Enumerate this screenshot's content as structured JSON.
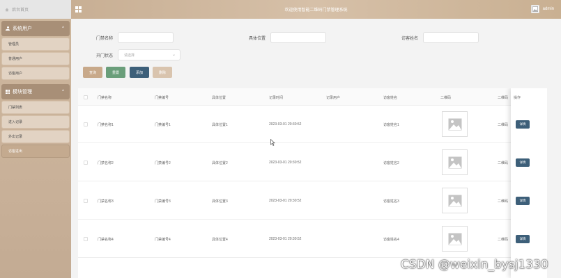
{
  "header": {
    "home_label": "后台首页",
    "title": "欢迎使用智能二维码门禁管理系统",
    "user": "admin"
  },
  "sidebar": {
    "groups": [
      {
        "title": "系统用户",
        "icon": "user-icon",
        "items": [
          "管理员",
          "普通用户",
          "访客用户"
        ]
      },
      {
        "title": "模块管理",
        "icon": "grid-icon",
        "items": [
          "门禁列表",
          "进入记录",
          "外出记录",
          "访客进出"
        ]
      }
    ],
    "active_item": "访客进出"
  },
  "search": {
    "door_name_label": "门禁名称",
    "location_label": "具体位置",
    "visitor_label": "访客姓名",
    "status_label": "开门状态",
    "status_placeholder": "请选择",
    "buttons": {
      "query": "查询",
      "reset": "重置",
      "add": "添加",
      "delete": "删除"
    }
  },
  "colors": {
    "query_btn": "#c8a98a",
    "reset_btn": "#6a9e7a",
    "add_btn": "#3d5f79",
    "delete_btn": "#d9c4ae",
    "header_bg": "#cfb79e",
    "sidebar_bg": "#c9b199"
  },
  "table": {
    "columns": [
      "门禁名称",
      "门禁编号",
      "具体位置",
      "记录时间",
      "记录用户",
      "访客姓名",
      "二维码",
      "二维码",
      "操作"
    ],
    "rows": [
      {
        "name": "门禁名称1",
        "code": "门禁编号1",
        "location": "具体位置1",
        "time": "2023-03-01 20:30:52",
        "user": "",
        "visitor": "访客姓名1",
        "qr2": "二维码",
        "action": "详情"
      },
      {
        "name": "门禁名称2",
        "code": "门禁编号2",
        "location": "具体位置2",
        "time": "2023-03-01 20:30:52",
        "user": "",
        "visitor": "访客姓名2",
        "qr2": "二维码",
        "action": "详情"
      },
      {
        "name": "门禁名称3",
        "code": "门禁编号3",
        "location": "具体位置3",
        "time": "2023-03-01 20:30:52",
        "user": "",
        "visitor": "访客姓名3",
        "qr2": "二维码",
        "action": "详情"
      },
      {
        "name": "门禁名称4",
        "code": "门禁编号4",
        "location": "具体位置4",
        "time": "2023-03-01 20:30:52",
        "user": "",
        "visitor": "访客姓名4",
        "qr2": "二维码",
        "action": "详情"
      }
    ]
  },
  "watermark": "CSDN @weixin_bysj1330"
}
